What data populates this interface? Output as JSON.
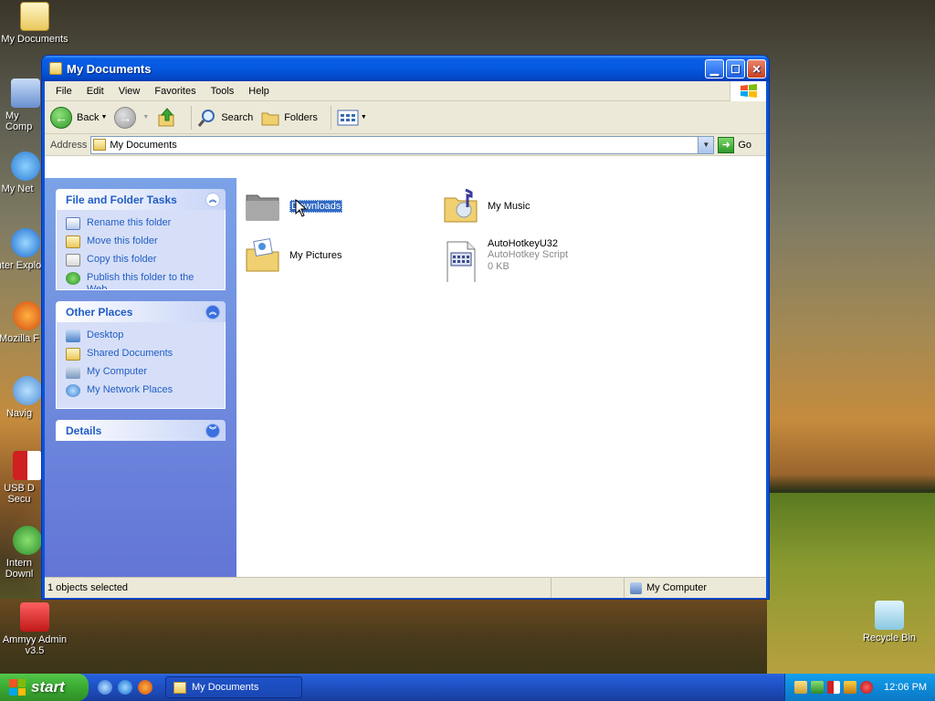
{
  "desktop": {
    "icons": [
      {
        "label": "My Documents"
      },
      {
        "label": "My Comp"
      },
      {
        "label": "My Net"
      },
      {
        "label": "Inter Explo"
      },
      {
        "label": "Mozilla F"
      },
      {
        "label": "Navig"
      },
      {
        "label": "USB D Secu"
      },
      {
        "label": "Intern Downl"
      },
      {
        "label": "Ammyy Admin v3.5"
      },
      {
        "label": "Recycle Bin"
      }
    ]
  },
  "window": {
    "title": "My Documents",
    "menu": [
      "File",
      "Edit",
      "View",
      "Favorites",
      "Tools",
      "Help"
    ],
    "toolbar": {
      "back": "Back",
      "search": "Search",
      "folders": "Folders"
    },
    "address": {
      "label": "Address",
      "value": "My Documents",
      "go": "Go"
    },
    "tasks_panel": {
      "title": "File and Folder Tasks",
      "items": [
        "Rename this folder",
        "Move this folder",
        "Copy this folder",
        "Publish this folder to the Web"
      ]
    },
    "places_panel": {
      "title": "Other Places",
      "items": [
        "Desktop",
        "Shared Documents",
        "My Computer",
        "My Network Places"
      ]
    },
    "details_panel": {
      "title": "Details"
    },
    "files": [
      {
        "name": "Downloads",
        "selected": true
      },
      {
        "name": "My Music"
      },
      {
        "name": "My Pictures"
      },
      {
        "name": "AutoHotkeyU32",
        "type": "AutoHotkey Script",
        "size": "0 KB"
      }
    ],
    "status": {
      "left": "1 objects selected",
      "right": "My Computer"
    }
  },
  "taskbar": {
    "start": "start",
    "task": "My Documents",
    "clock": "12:06 PM"
  },
  "colors": {
    "xp_blue": "#0a53d8",
    "panel_link": "#215dc6",
    "start_green": "#3aaa31",
    "selection": "#316ac5"
  }
}
